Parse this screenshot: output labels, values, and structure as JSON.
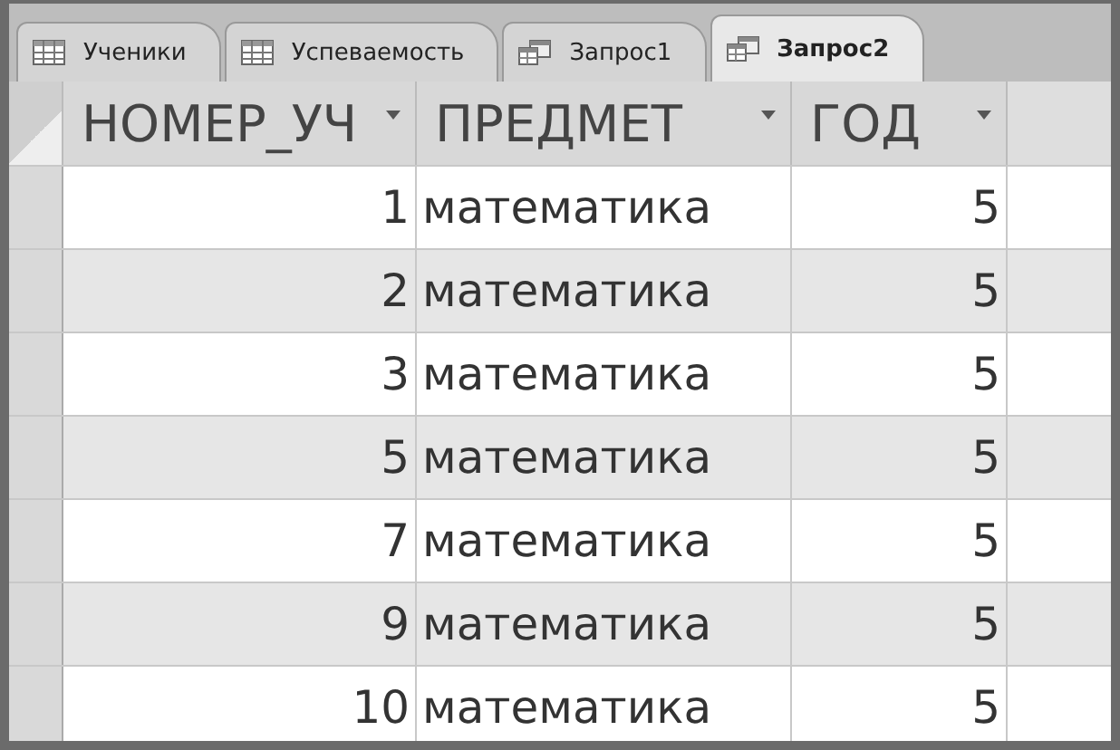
{
  "tabs": [
    {
      "label": "Ученики",
      "kind": "table",
      "selected": false
    },
    {
      "label": "Успеваемость",
      "kind": "table",
      "selected": false
    },
    {
      "label": "Запрос1",
      "kind": "query",
      "selected": false
    },
    {
      "label": "Запрос2",
      "kind": "query",
      "selected": true
    }
  ],
  "table": {
    "columns": [
      "НОМЕР_УЧ",
      "ПРЕДМЕТ",
      "ГОД"
    ],
    "rows": [
      [
        "1",
        "математика",
        "5"
      ],
      [
        "2",
        "математика",
        "5"
      ],
      [
        "3",
        "математика",
        "5"
      ],
      [
        "5",
        "математика",
        "5"
      ],
      [
        "7",
        "математика",
        "5"
      ],
      [
        "9",
        "математика",
        "5"
      ],
      [
        "10",
        "математика",
        "5"
      ]
    ]
  }
}
